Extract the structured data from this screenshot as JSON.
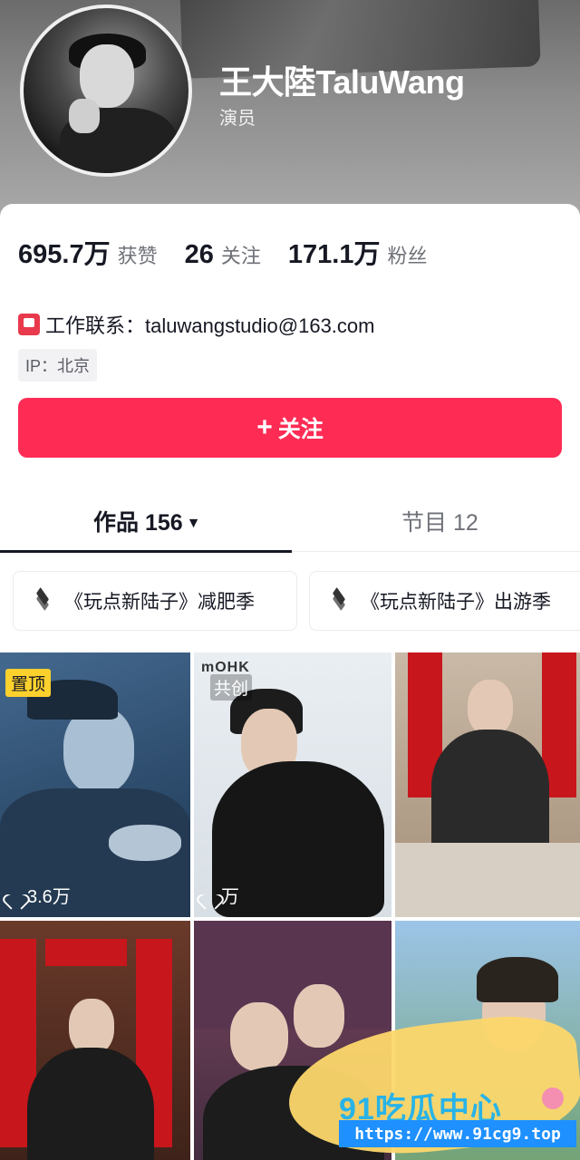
{
  "profile": {
    "name": "王大陸TaluWang",
    "role": "演员"
  },
  "stats": [
    {
      "value": "695.7万",
      "label": "获赞"
    },
    {
      "value": "26",
      "label": "关注"
    },
    {
      "value": "171.1万",
      "label": "粉丝"
    }
  ],
  "contact": {
    "text": "工作联系：taluwangstudio@163.com",
    "ip": "IP：北京"
  },
  "follow_button": {
    "plus": "+",
    "label": "关注",
    "color": "#fe2c55"
  },
  "tabs": {
    "works": "作品 156",
    "works_caret": "▼",
    "shows": "节目 12"
  },
  "collections": [
    {
      "label": "《玩点新陆子》减肥季",
      "icon": "layers-icon"
    },
    {
      "label": "《玩点新陆子》出游季",
      "icon": "layers-icon"
    }
  ],
  "videos": [
    {
      "badge": "置顶",
      "likes": "3.6万"
    },
    {
      "badge": "共创",
      "brand": "mOHK",
      "likes": "万"
    },
    {
      "likes": ""
    },
    {
      "likes": ""
    },
    {
      "likes": ""
    },
    {
      "likes": ""
    }
  ],
  "watermark": {
    "title": "91吃瓜中心",
    "url": "https://www.91cg9.top"
  }
}
